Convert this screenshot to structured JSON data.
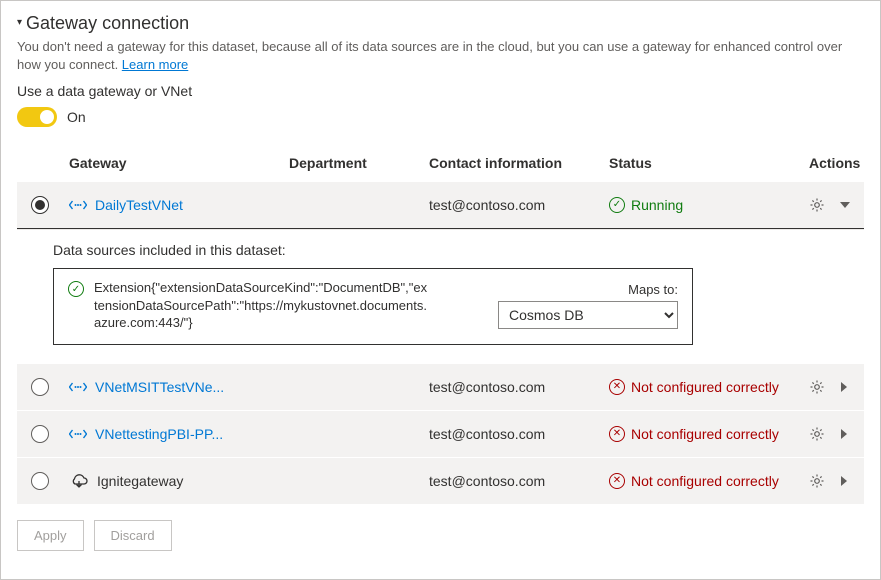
{
  "header": {
    "title": "Gateway connection",
    "description_prefix": "You don't need a gateway for this dataset, because all of its data sources are in the cloud, but you can use a gateway for enhanced control over how you connect. ",
    "learn_more": "Learn more"
  },
  "toggle": {
    "subheading": "Use a data gateway or VNet",
    "state_label": "On"
  },
  "columns": {
    "gateway": "Gateway",
    "department": "Department",
    "contact": "Contact information",
    "status": "Status",
    "actions": "Actions"
  },
  "status_labels": {
    "running": "Running",
    "not_configured": "Not configured correctly"
  },
  "gateways": [
    {
      "selected": true,
      "type": "vnet",
      "name": "DailyTestVNet",
      "department": "",
      "contact": "test@contoso.com",
      "status": "running",
      "expanded": true
    },
    {
      "selected": false,
      "type": "vnet",
      "name": "VNetMSITTestVNe...",
      "department": "",
      "contact": "test@contoso.com",
      "status": "not_configured",
      "expanded": false
    },
    {
      "selected": false,
      "type": "vnet",
      "name": "VNettestingPBI-PP...",
      "department": "",
      "contact": "test@contoso.com",
      "status": "not_configured",
      "expanded": false
    },
    {
      "selected": false,
      "type": "cloud",
      "name": "Ignitegateway",
      "department": "",
      "contact": "test@contoso.com",
      "status": "not_configured",
      "expanded": false
    }
  ],
  "details": {
    "title": "Data sources included in this dataset:",
    "source_text": "Extension{\"extensionDataSourceKind\":\"DocumentDB\",\"extensionDataSourcePath\":\"https://mykustovnet.documents.azure.com:443/\"}",
    "maps_label": "Maps to:",
    "maps_value": "Cosmos DB"
  },
  "buttons": {
    "apply": "Apply",
    "discard": "Discard"
  }
}
